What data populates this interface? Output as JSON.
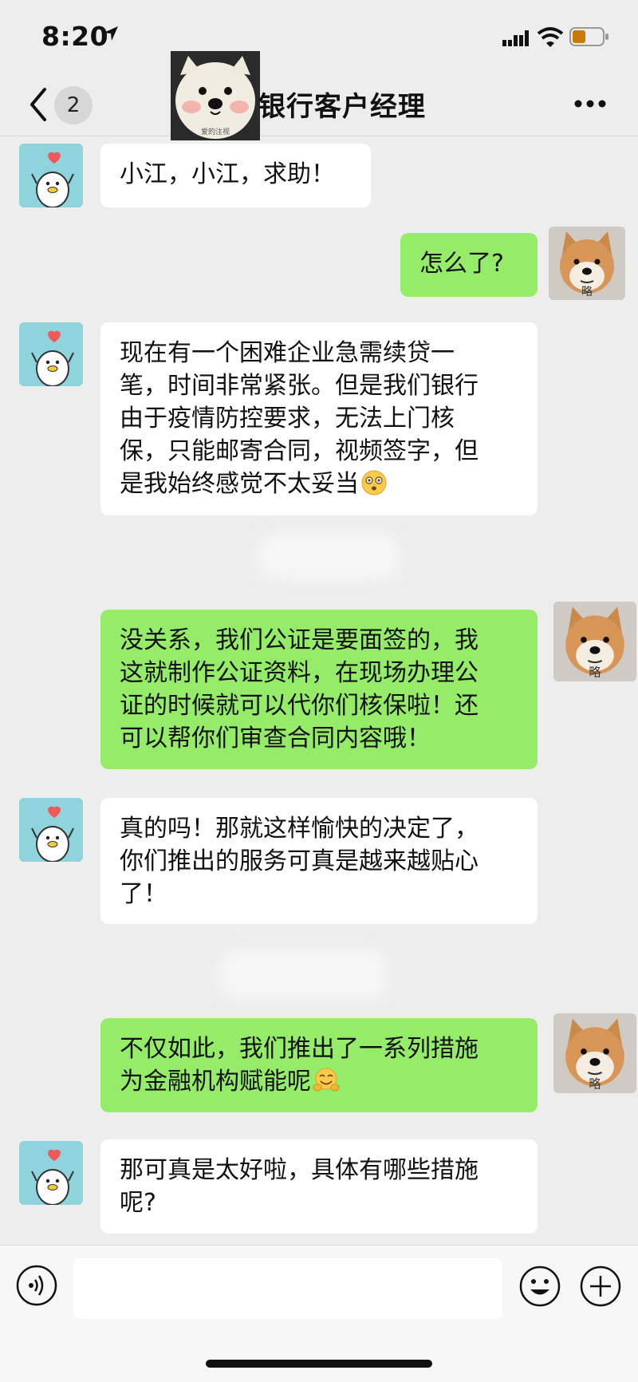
{
  "status_bar": {
    "time": "8:20"
  },
  "header": {
    "back_count": "2",
    "title": "银行客户经理",
    "avatar_caption": "爱的注视"
  },
  "messages": [
    {
      "side": "in",
      "text": "小江，小江，求助！"
    },
    {
      "side": "out",
      "text": "怎么了?"
    },
    {
      "side": "in",
      "text": "现在有一个困难企业急需续贷一\n笔，时间非常紧张。但是我们银行\n由于疫情防控要求，无法上门核\n保，只能邮寄合同，视频签字，但\n是我始终感觉不太妥当",
      "emoji": "dizzy-face-emoji"
    },
    {
      "side": "out",
      "text": "没关系，我们公证是要面签的，我\n这就制作公证资料，在现场办理公\n证的时候就可以代你们核保啦！还\n可以帮你们审查合同内容哦！"
    },
    {
      "side": "in",
      "text": "真的吗！那就这样愉快的决定了，\n你们推出的服务可真是越来越贴心\n了！"
    },
    {
      "side": "out",
      "text": "不仅如此，我们推出了一系列措施\n为金融机构赋能呢",
      "emoji": "hugging-face-emoji"
    },
    {
      "side": "in",
      "text": "那可真是太好啦，具体有哪些措施\n呢?"
    }
  ],
  "dog_avatar_caption": "略",
  "colors": {
    "background": "#ededed",
    "incoming_bubble": "#ffffff",
    "outgoing_bubble": "#95ec69",
    "avatar_teal": "#8fd3dc"
  },
  "icons": {
    "voice": "voice-icon",
    "emoji": "smiley-icon",
    "more": "plus-icon",
    "back": "chevron-left-icon",
    "menu": "more-dots-icon"
  }
}
